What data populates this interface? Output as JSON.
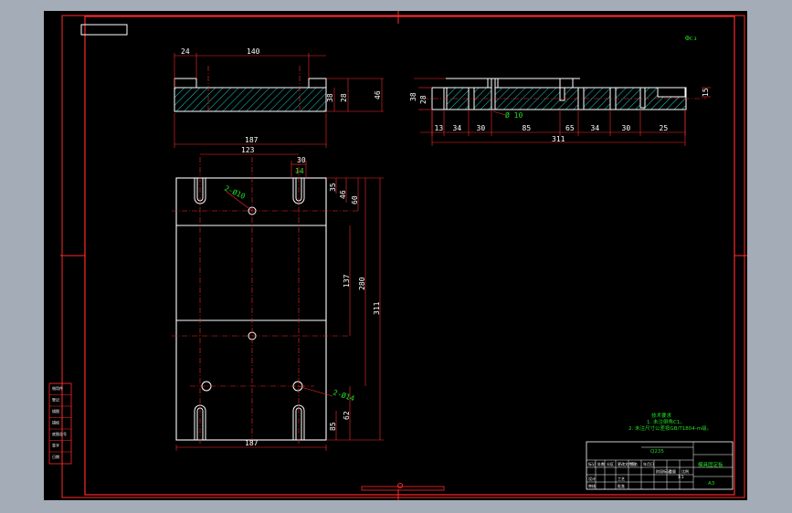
{
  "drawing": {
    "corner_note": "⚙ᴄ₃",
    "top_view": {
      "dims": [
        "24",
        "140",
        "38",
        "28",
        "46",
        "187"
      ]
    },
    "side_view": {
      "dims_left": [
        "38",
        "28",
        "15"
      ],
      "diameter": "Ø 10",
      "dims_bottom": [
        "13",
        "34",
        "30",
        "85",
        "65",
        "34",
        "30",
        "25"
      ],
      "total": "311"
    },
    "plan_view": {
      "dims_top": [
        "123",
        "30",
        "14"
      ],
      "hole_label_1": "2-Ø10",
      "hole_label_2": "2-Ø14",
      "dims_right": [
        "35",
        "46",
        "60",
        "137",
        "280",
        "311",
        "85",
        "62"
      ],
      "dim_bottom": "187"
    },
    "tech_notes": {
      "title": "技术要求",
      "lines": [
        "1. 未注倒角C1。",
        "2. 未注尺寸公差按GB/T1804-m级。"
      ]
    },
    "title_block": {
      "material": "Q235",
      "part_name": "模具固定板",
      "scale_label": "1:1",
      "sheet": "A3",
      "small_cells": [
        "标记",
        "处数",
        "分区",
        "更改文件号",
        "签名",
        "年月日",
        "设计",
        "审核",
        "工艺",
        "批准",
        "阶段标记",
        "重量",
        "比例"
      ]
    },
    "side_table": [
      "借用件",
      "登记",
      "描图",
      "描校",
      "底图总号",
      "签字",
      "日期"
    ]
  },
  "colors": {
    "background": "#000000",
    "border": "#ff2a2a",
    "geometry": "#ffffff",
    "dimension": "#ff2a2a",
    "hatch": "#19d4d4",
    "text": "#22dd22"
  }
}
